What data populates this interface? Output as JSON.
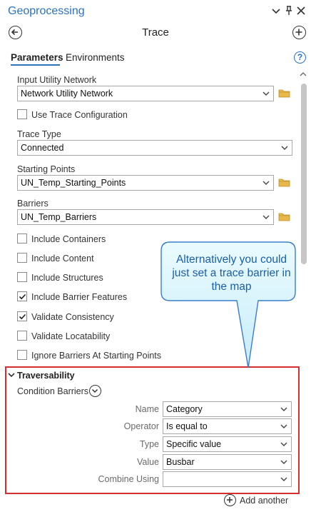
{
  "window": {
    "title": "Geoprocessing"
  },
  "header": {
    "title": "Trace"
  },
  "tabs": [
    {
      "label": "Parameters",
      "active": true
    },
    {
      "label": "Environments",
      "active": false
    }
  ],
  "params": {
    "input_network": {
      "label": "Input Utility Network",
      "value": "Network Utility Network"
    },
    "use_trace_config": {
      "label": "Use Trace Configuration",
      "checked": false
    },
    "trace_type": {
      "label": "Trace Type",
      "value": "Connected"
    },
    "starting_points": {
      "label": "Starting Points",
      "value": "UN_Temp_Starting_Points"
    },
    "barriers": {
      "label": "Barriers",
      "value": "UN_Temp_Barriers"
    },
    "checkboxes": [
      {
        "label": "Include Containers",
        "checked": false
      },
      {
        "label": "Include Content",
        "checked": false
      },
      {
        "label": "Include Structures",
        "checked": false
      },
      {
        "label": "Include Barrier Features",
        "checked": true
      },
      {
        "label": "Validate Consistency",
        "checked": true
      },
      {
        "label": "Validate Locatability",
        "checked": false
      },
      {
        "label": "Ignore Barriers At Starting Points",
        "checked": false
      }
    ]
  },
  "traversability": {
    "title": "Traversability",
    "condition_barriers_label": "Condition Barriers",
    "rows": [
      {
        "label": "Name",
        "value": "Category"
      },
      {
        "label": "Operator",
        "value": "Is equal to"
      },
      {
        "label": "Type",
        "value": "Specific value"
      },
      {
        "label": "Value",
        "value": "Busbar"
      },
      {
        "label": "Combine Using",
        "value": ""
      }
    ],
    "add_another_label": "Add another"
  },
  "callout": {
    "text": "Alternatively you could just set a trace barrier in the map"
  },
  "colors": {
    "accent": "#2b73ba",
    "highlight_border": "#d32f2f",
    "callout_fill": "#d9f3fb",
    "callout_text": "#1a5fa8"
  }
}
